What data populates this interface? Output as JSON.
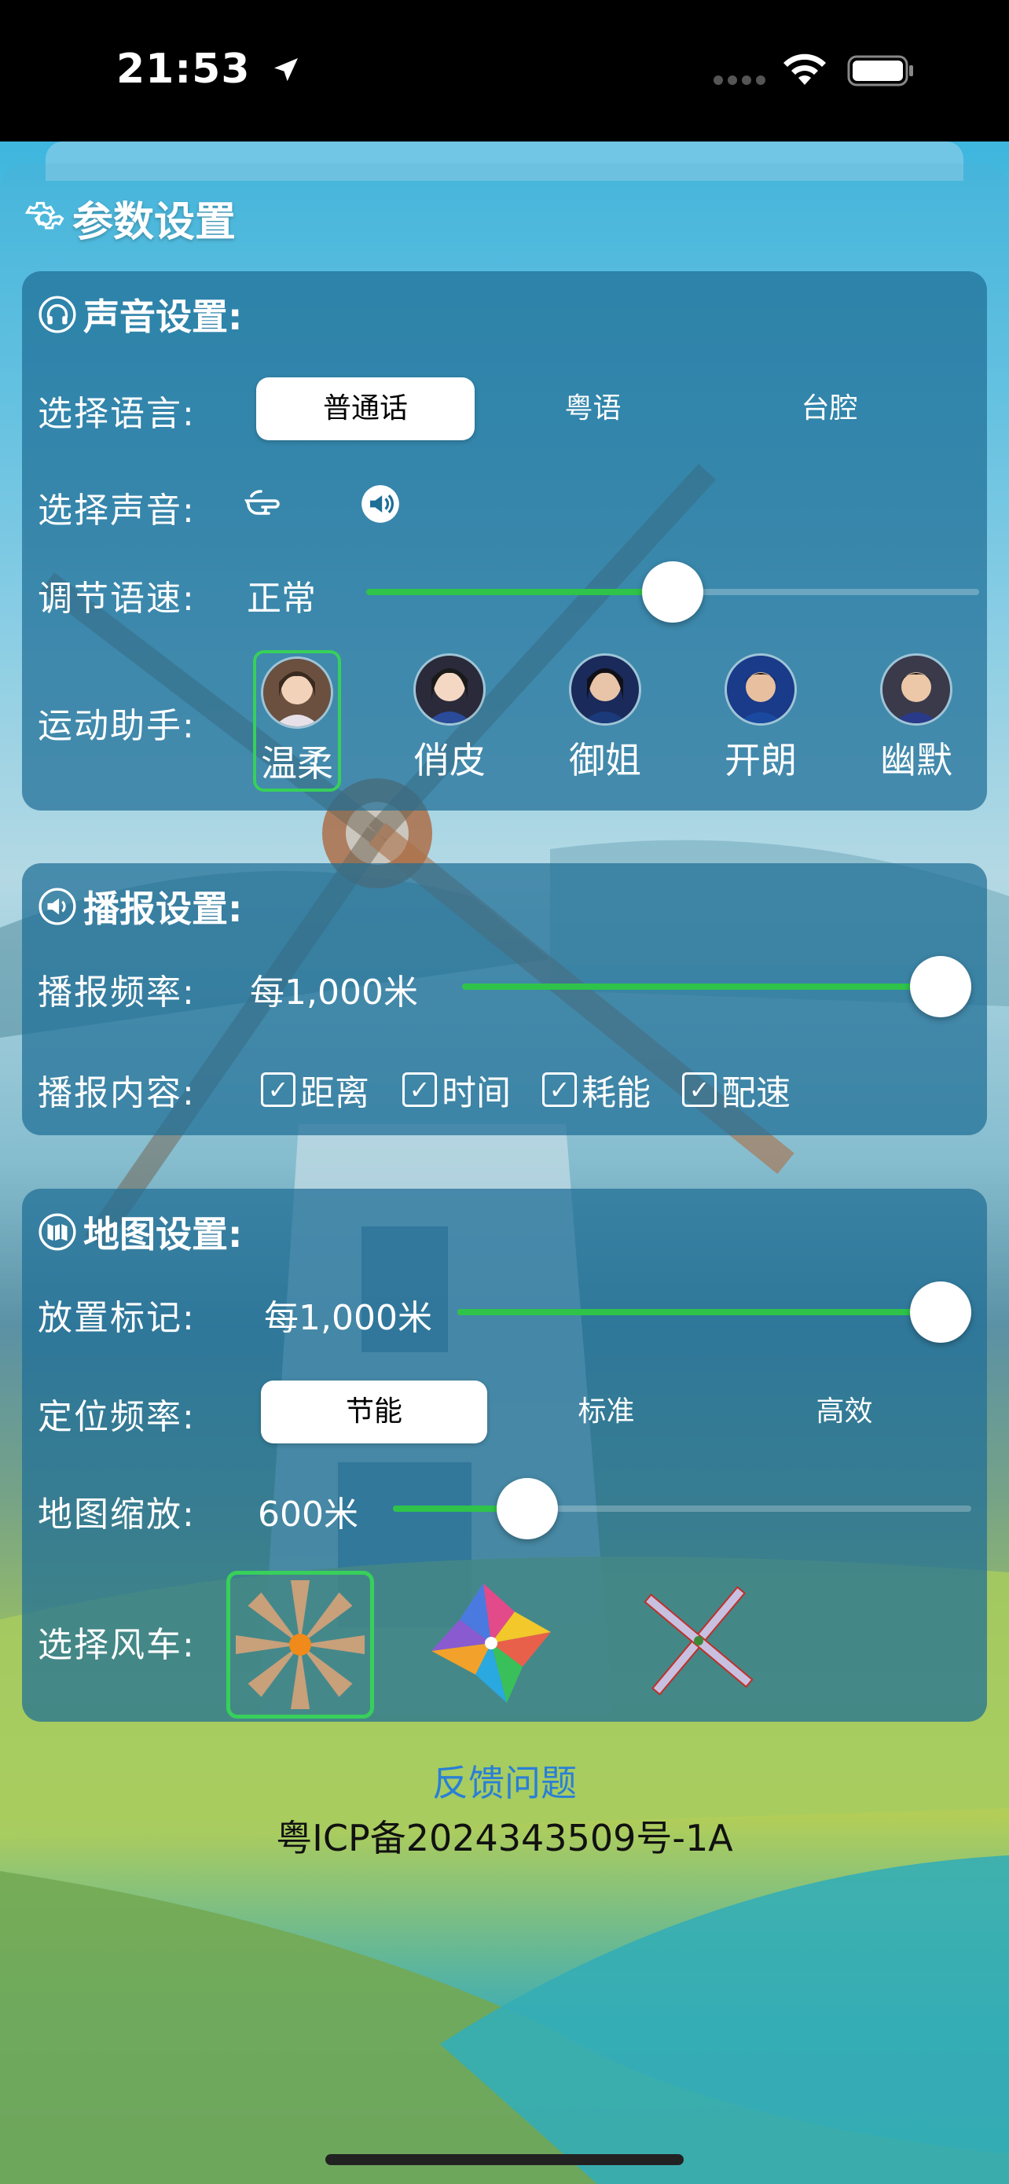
{
  "status_bar": {
    "time": "21:53"
  },
  "page": {
    "title": "参数设置"
  },
  "sound": {
    "title": "声音设置:",
    "language_label": "选择语言:",
    "languages": [
      "普通话",
      "粤语",
      "台腔"
    ],
    "voice_label": "选择声音:",
    "speed_label": "调节语速:",
    "speed_value": "正常",
    "speed_fraction": 0.5,
    "assistant_label": "运动助手:",
    "assistants": [
      "温柔",
      "俏皮",
      "御姐",
      "开朗",
      "幽默"
    ]
  },
  "broadcast": {
    "title": "播报设置:",
    "frequency_label": "播报频率:",
    "frequency_value": "每1,000米",
    "frequency_fraction": 1.0,
    "content_label": "播报内容:",
    "contents": [
      "距离",
      "时间",
      "耗能",
      "配速"
    ]
  },
  "map": {
    "title": "地图设置:",
    "marker_label": "放置标记:",
    "marker_value": "每1,000米",
    "marker_fraction": 1.0,
    "locate_label": "定位频率:",
    "locate_options": [
      "节能",
      "标准",
      "高效"
    ],
    "zoom_label": "地图缩放:",
    "zoom_value": "600米",
    "zoom_fraction": 0.2,
    "windmill_label": "选择风车:"
  },
  "footer": {
    "feedback": "反馈问题",
    "icp": "粤ICP备2024343509号-1A"
  },
  "colors": {
    "accent_green": "#2fc34a",
    "link_blue": "#2a7fd6",
    "panel": "#1e6e96"
  }
}
